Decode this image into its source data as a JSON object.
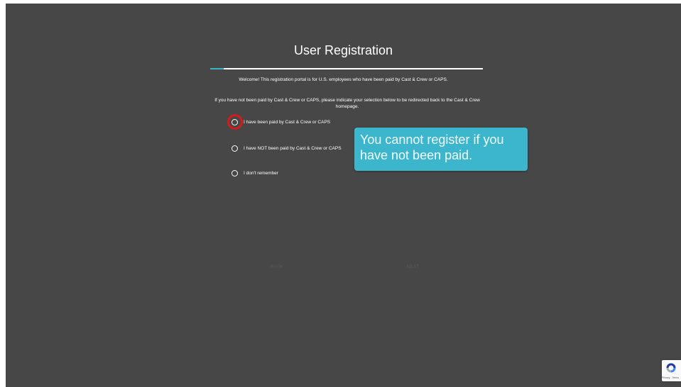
{
  "page": {
    "title": "User Registration",
    "progress_percent": 5,
    "welcome": "Welcome! This registration portal is for U.S. employees who have been paid by Cast & Crew or CAPS.",
    "instruction": "If you have not been paid by Cast & Crew or CAPS, please indicate your selection below to be redirected back to the Cast & Crew homepage."
  },
  "options": [
    {
      "label": "I have been paid by Cast & Crew or CAPS"
    },
    {
      "label": "I have NOT been paid by Cast & Crew or CAPS"
    },
    {
      "label": "I don't remember"
    }
  ],
  "tooltip": {
    "text": "You cannot register if you have not been paid."
  },
  "nav": {
    "back": "BACK",
    "next": "NEXT"
  },
  "recaptcha": {
    "text": "Privacy - Terms"
  },
  "colors": {
    "accent": "#3bb3c3",
    "background": "#474747",
    "highlight": "#d41a1a",
    "tooltip": "#3cb6cc"
  }
}
